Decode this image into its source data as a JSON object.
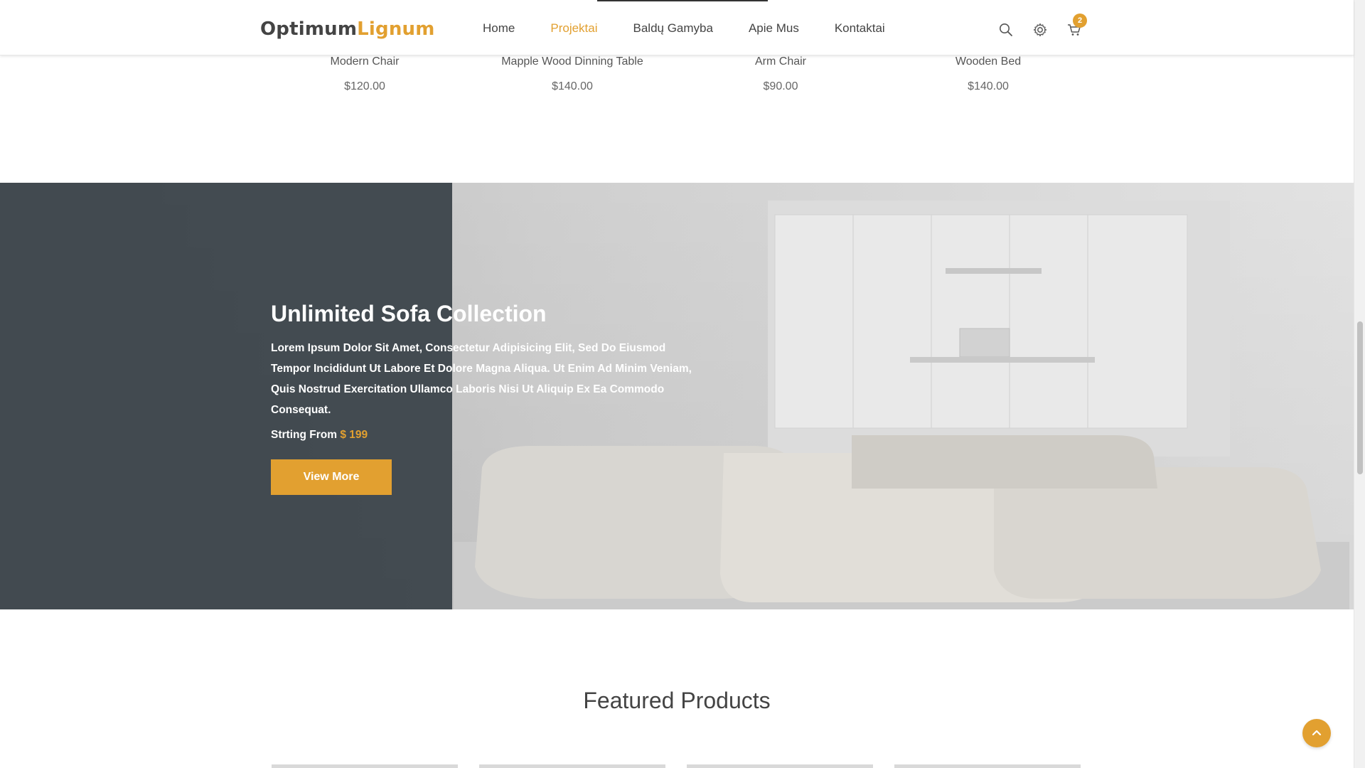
{
  "header": {
    "logo_main": "Optimum",
    "logo_accent": "Lignum",
    "nav": [
      {
        "label": "Home",
        "active": false
      },
      {
        "label": "Projektai",
        "active": true
      },
      {
        "label": "Baldų Gamyba",
        "active": false
      },
      {
        "label": "Apie Mus",
        "active": false
      },
      {
        "label": "Kontaktai",
        "active": false
      }
    ],
    "icons": [
      "search-icon",
      "gear-icon",
      "cart-icon"
    ],
    "cart_count": "2"
  },
  "products_top": [
    {
      "name": "Modern Chair",
      "price": "$120.00"
    },
    {
      "name": "Mapple Wood Dinning Table",
      "price": "$140.00"
    },
    {
      "name": "Arm Chair",
      "price": "$90.00"
    },
    {
      "name": "Wooden Bed",
      "price": "$140.00"
    }
  ],
  "hero": {
    "title": "Unlimited Sofa Collection",
    "description": "Lorem Ipsum Dolor Sit Amet, Consectetur Adipisicing Elit, Sed Do Eiusmod Tempor Incididunt Ut Labore Et Dolore Magna Aliqua. Ut Enim Ad Minim Veniam, Quis Nostrud Exercitation Ullamco Laboris Nisi Ut Aliquip Ex Ea Commodo Consequat.",
    "price_prefix": "Strting From",
    "price_value": "$ 199",
    "button_label": "View More"
  },
  "featured": {
    "title": "Featured Products"
  },
  "colors": {
    "accent": "#e2a030",
    "hero_left": "#3a4349"
  }
}
